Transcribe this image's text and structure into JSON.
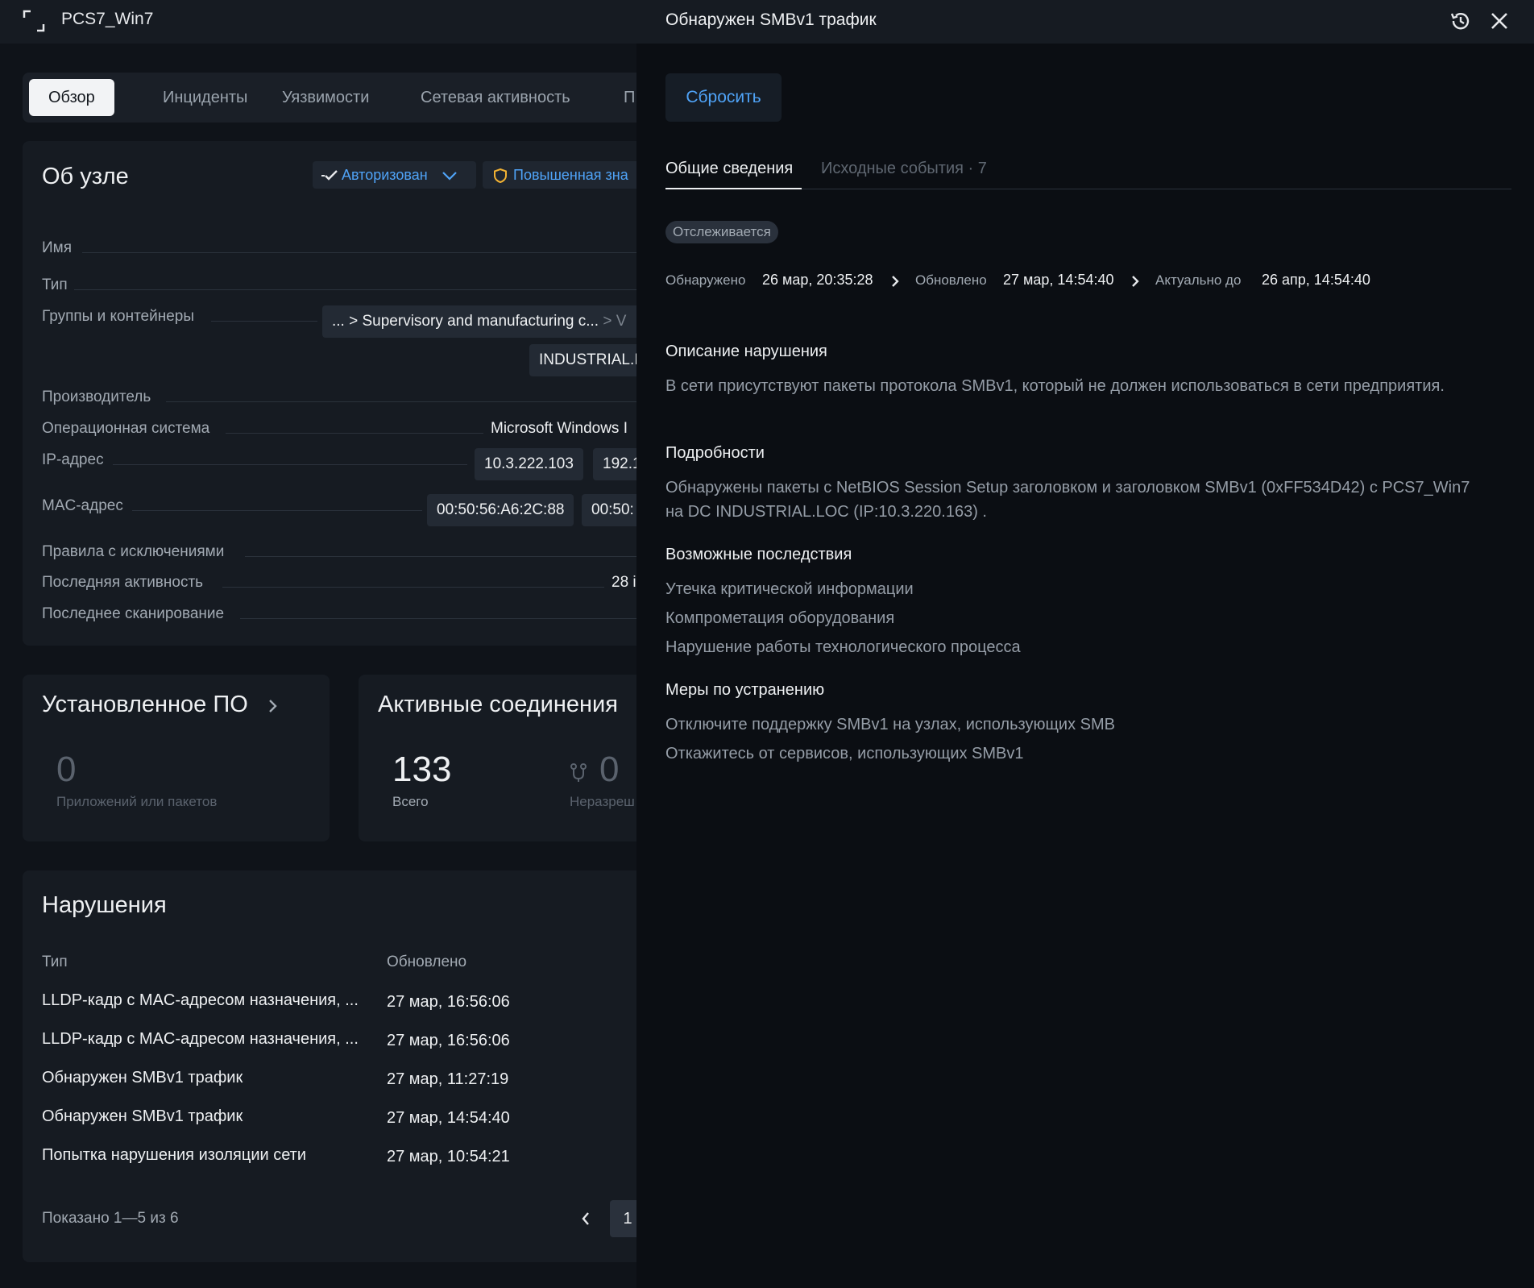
{
  "node": {
    "title": "PCS7_Win7",
    "tabs": [
      "Обзор",
      "Инциденты",
      "Уязвимости",
      "Сетевая активность",
      "П"
    ],
    "about": {
      "title": "Об узле",
      "status_authorized": "Авторизован",
      "status_importance": "Повышенная зна",
      "fields": {
        "name": "Имя",
        "type": "Тип",
        "groups": "Группы и контейнеры",
        "groups_path_prefix": "... >",
        "groups_path_main": "Supervisory and manufacturing c...",
        "groups_path_suffix": "> V",
        "groups_second": "INDUSTRIAL.I",
        "vendor": "Производитель",
        "os": "Операционная система",
        "os_value": "Microsoft Windows I",
        "ip": "IP-адрес",
        "ip_values": [
          "10.3.222.103",
          "192.1"
        ],
        "mac": "MAC-адрес",
        "mac_values": [
          "00:50:56:A6:2C:88",
          "00:50:"
        ],
        "exception_rules": "Правила с исключениями",
        "last_activity": "Последняя активность",
        "last_activity_value": "28 i",
        "last_scan": "Последнее сканирование"
      }
    },
    "software": {
      "title": "Установленное ПО",
      "count": "0",
      "label": "Приложений или пакетов"
    },
    "connections": {
      "title": "Активные соединения",
      "total": "133",
      "total_label": "Всего",
      "unauthorized": "0",
      "unauthorized_label": "Неразреш"
    },
    "violations": {
      "title": "Нарушения",
      "col_type": "Тип",
      "col_updated": "Обновлено",
      "rows": [
        {
          "type": "LLDP-кадр с MAC-адресом назначения, ...",
          "updated": "27 мар, 16:56:06"
        },
        {
          "type": "LLDP-кадр с MAC-адресом назначения, ...",
          "updated": "27 мар, 16:56:06"
        },
        {
          "type": "Обнаружен SMBv1 трафик",
          "updated": "27 мар, 11:27:19"
        },
        {
          "type": "Обнаружен SMBv1 трафик",
          "updated": "27 мар, 14:54:40"
        },
        {
          "type": "Попытка нарушения изоляции сети",
          "updated": "27 мар, 10:54:21"
        }
      ],
      "shown": "Показано 1—5 из 6",
      "page": "1"
    }
  },
  "drawer": {
    "title": "Обнаружен SMBv1 трафик",
    "reset": "Сбросить",
    "tab_general": "Общие сведения",
    "tab_events": "Исходные события · 7",
    "status": "Отслеживается",
    "detected_label": "Обнаружено",
    "detected_value": "26 мар, 20:35:28",
    "updated_label": "Обновлено",
    "updated_value": "27 мар, 14:54:40",
    "valid_label": "Актуально до",
    "valid_value": "26 апр, 14:54:40",
    "description_title": "Описание нарушения",
    "description_text": "В сети присутствуют пакеты протокола SMBv1, который не должен использоваться в сети предприятия.",
    "details_title": "Подробности",
    "details_text": "Обнаружены пакеты с NetBIOS Session Setup заголовком и заголовком SMBv1 (0xFF534D42) с PCS7_Win7 на DC INDUSTRIAL.LOC (IP:10.3.220.163) .",
    "consequences_title": "Возможные последствия",
    "consequences": [
      "Утечка критической информации",
      "Компрометация оборудования",
      "Нарушение работы технологического процесса"
    ],
    "remediation_title": "Меры по устранению",
    "remediation": [
      "Отключите поддержку SMBv1 на узлах, использующих SMB",
      "Откажитесь от сервисов, использующих SMBv1"
    ]
  },
  "colors": {
    "accent": "#4fa3f7",
    "warning": "#f2b233",
    "background": "#0e1117",
    "panel": "#161b22"
  },
  "icons": [
    "expand-icon",
    "check-icon",
    "chevron-down-icon",
    "shield-icon",
    "chevron-right-icon",
    "history-icon",
    "close-icon",
    "unauthorized-icon",
    "chevron-left-icon"
  ]
}
